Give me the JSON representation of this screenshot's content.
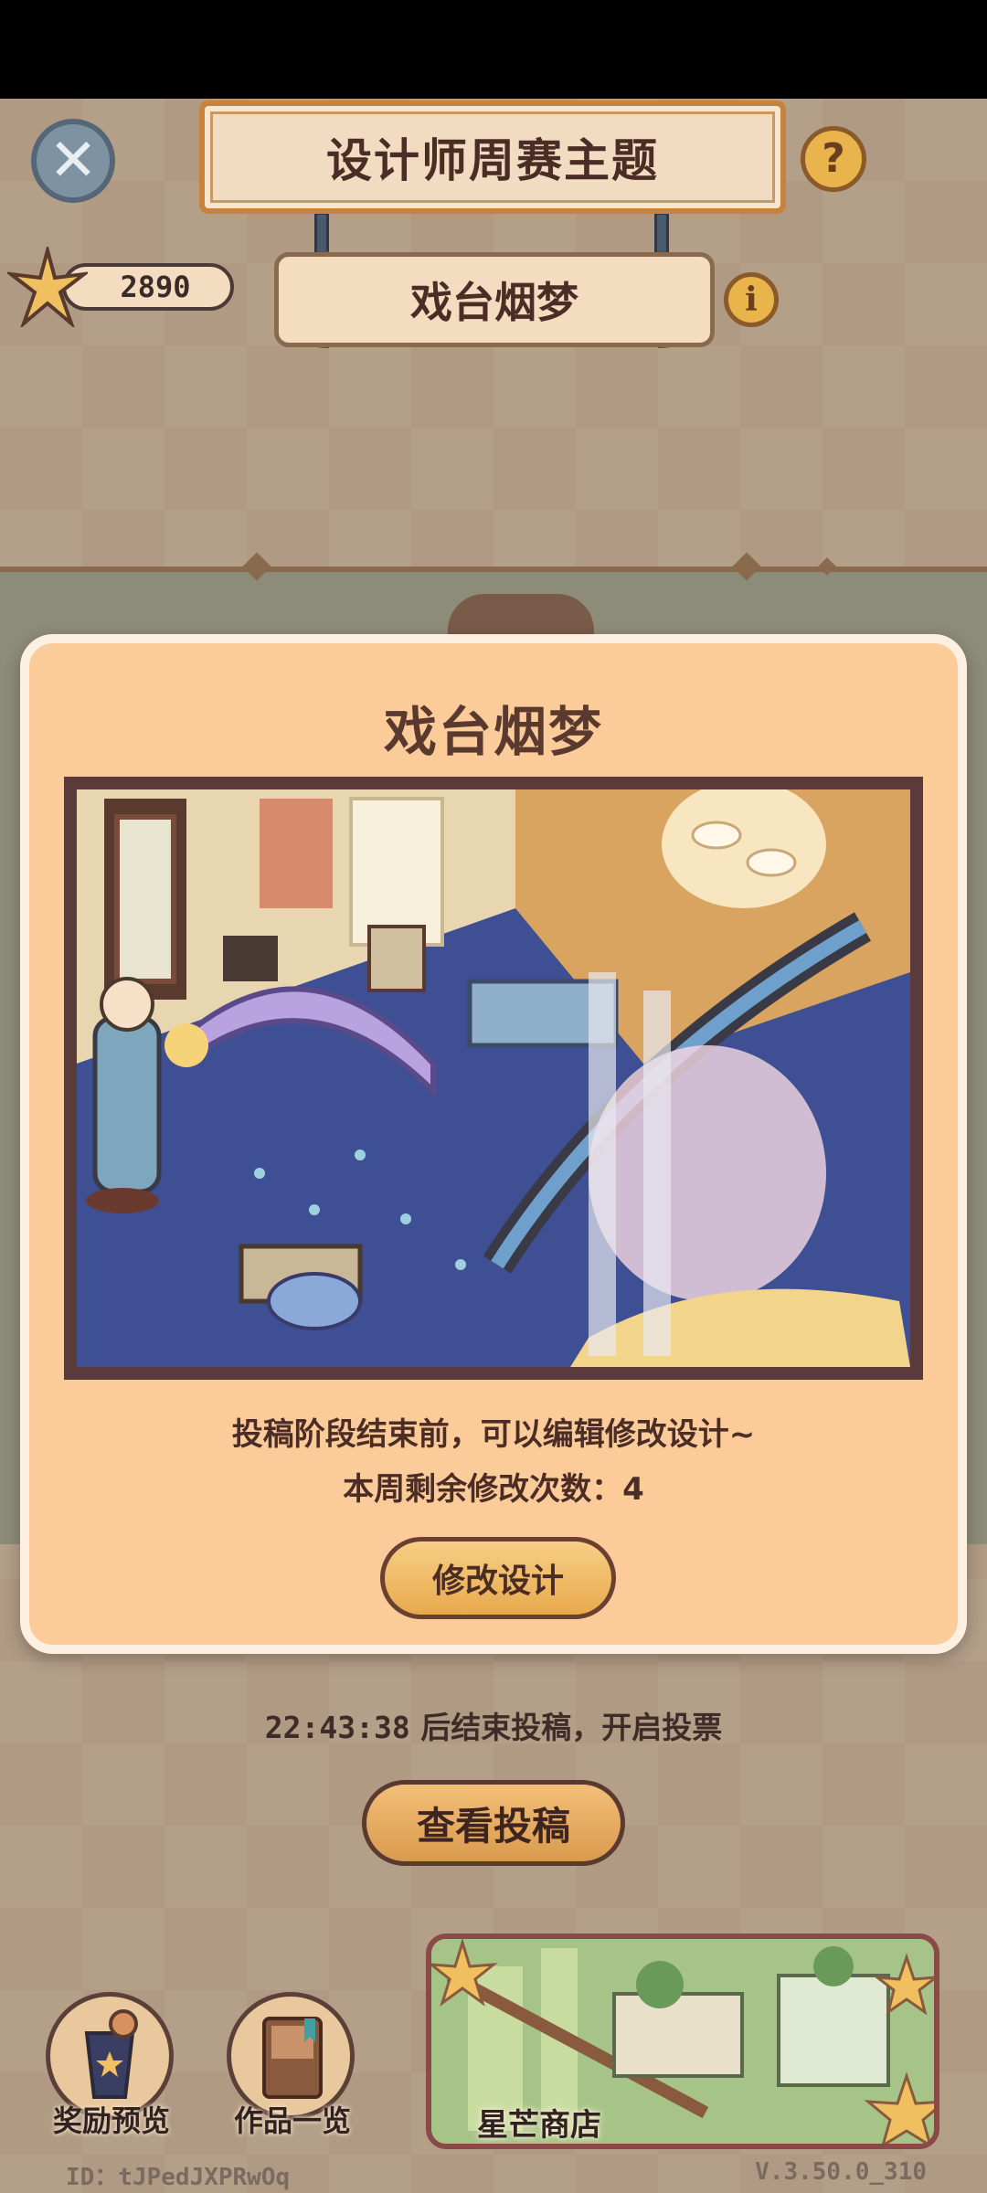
{
  "header": {
    "title": "设计师周赛主题",
    "theme_name": "戏台烟梦",
    "star_count": "2890"
  },
  "icons": {
    "close": "close-icon",
    "help": "question-mark-icon",
    "info": "info-icon",
    "currency": "star-icon"
  },
  "modal": {
    "title": "戏台烟梦",
    "description": "投稿阶段结束前，可以编辑修改设计~",
    "remaining_label": "本周剩余修改次数：4",
    "edit_button": "修改设计"
  },
  "countdown": {
    "time": "22:43:38",
    "text": "后结束投稿，开启投票"
  },
  "view_submissions_button": "查看投稿",
  "bottom_nav": {
    "rewards_preview": "奖励预览",
    "works_overview": "作品一览",
    "star_shop": "星芒商店"
  },
  "footer": {
    "user_id": "ID：tJPedJXPRwOq",
    "version": "V.3.50.0_310"
  },
  "colors": {
    "modal_bg": "#fbcb9a",
    "button_gold": "#e8a94c",
    "text_brown": "#4b2d25"
  }
}
